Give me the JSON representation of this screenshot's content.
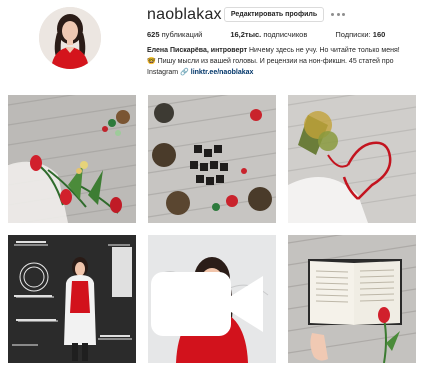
{
  "profile": {
    "username": "naoblakax",
    "edit_label": "Редактировать профиль",
    "more_icon": "more-dots-icon",
    "avatar_icon": "avatar"
  },
  "stats": {
    "posts_count": "625",
    "posts_label": "публикаций",
    "followers_count": "16,2тыс.",
    "followers_label": "подписчиков",
    "following_label": "Подписки:",
    "following_count": "160"
  },
  "bio": {
    "name": "Елена Пискарёва, интроверт",
    "line1_rest": "Ничему здесь не учу. Но читайте только меня!",
    "line2": "🤓 Пишу мысли из вашей головы. И рецензии на нон-фикшн. 45 статей про",
    "line3_prefix": "Instagram",
    "link_arrow": "🔗",
    "link_text": "linktr.ee/naoblakax"
  },
  "posts": [
    {
      "name": "post-flatlay-tulips",
      "kind": "photo"
    },
    {
      "name": "post-letter-cubes",
      "kind": "photo"
    },
    {
      "name": "post-heart-ribbon",
      "kind": "photo"
    },
    {
      "name": "post-chalkboard-portrait",
      "kind": "photo"
    },
    {
      "name": "post-smiling-woman",
      "kind": "video",
      "icon": "video-camera-icon"
    },
    {
      "name": "post-book-tulip",
      "kind": "photo"
    }
  ]
}
